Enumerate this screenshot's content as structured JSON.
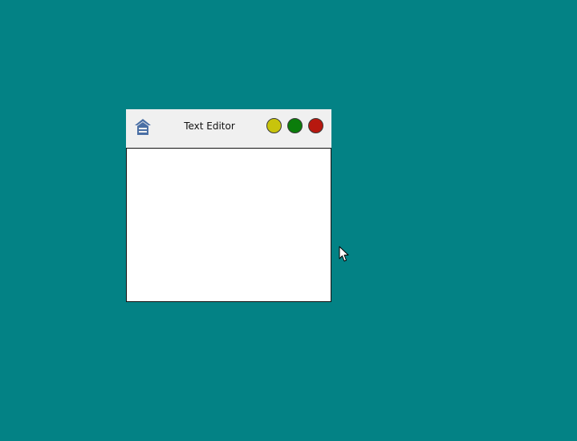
{
  "window": {
    "title": "Text Editor",
    "content_text": ""
  },
  "icons": {
    "home": "home-icon",
    "minimize": "yellow-circle-button",
    "maximize": "green-circle-button",
    "close": "red-circle-button",
    "pointer": "mouse-pointer-icon"
  },
  "colors": {
    "desktop": "#038285",
    "titlebar": "#f0f0f0",
    "home_icon": "#4a6fa5",
    "button_yellow": "#c8c40c",
    "button_green": "#0b7d0b",
    "button_red": "#b7180f"
  }
}
